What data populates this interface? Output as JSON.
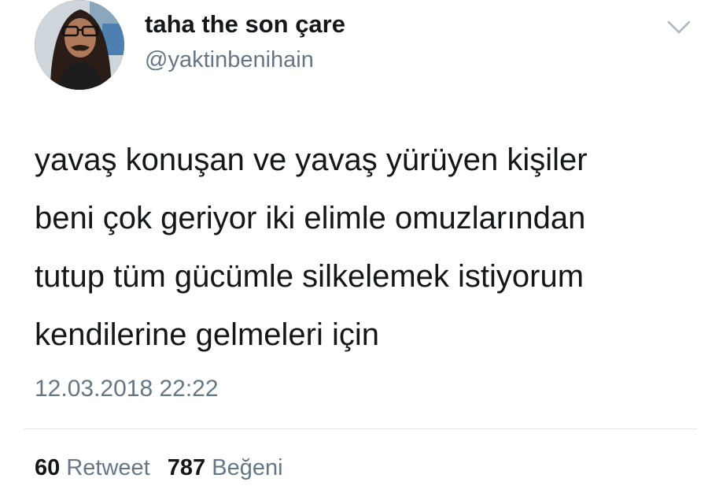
{
  "tweet": {
    "author": {
      "display_name": "taha the son çare",
      "handle": "@yaktinbenihain",
      "avatar_icon": "profile-photo"
    },
    "menu_icon": "chevron-down-icon",
    "text_lines": [
      "yavaş konuşan ve yavaş yürüyen kişiler",
      "beni çok geriyor iki elimle omuzlarından",
      "tutup tüm gücümle silkelemek istiyorum",
      "kendilerine gelmeleri için"
    ],
    "timestamp": "12.03.2018 22:22",
    "stats": {
      "retweets": {
        "count": "60",
        "label": "Retweet"
      },
      "likes": {
        "count": "787",
        "label": "Beğeni"
      }
    }
  },
  "colors": {
    "text": "#14171a",
    "secondary": "#657786",
    "divider": "#e1e8ed"
  }
}
